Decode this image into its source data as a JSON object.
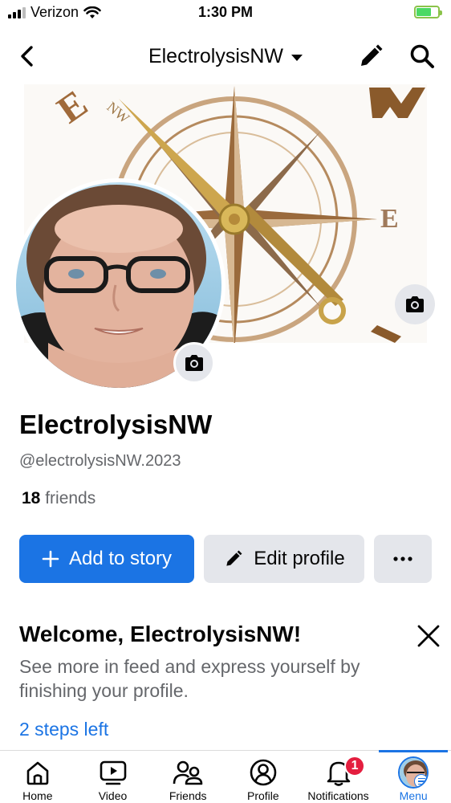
{
  "status_bar": {
    "carrier": "Verizon",
    "time": "1:30 PM"
  },
  "nav": {
    "title": "ElectrolysisNW"
  },
  "cover": {
    "logo_letters": [
      "E",
      "NW",
      "E"
    ],
    "accent": "#8a5a2b",
    "needle_color": "#c8a34a"
  },
  "profile": {
    "name": "ElectrolysisNW",
    "handle": "@electrolysisNW.2023",
    "friends_count": "18",
    "friends_label": "friends"
  },
  "actions": {
    "add_story": "Add to story",
    "edit_profile": "Edit profile",
    "more": "···"
  },
  "welcome": {
    "title": "Welcome, ElectrolysisNW!",
    "body": "See more in feed and express yourself by finishing your profile.",
    "steps": "2 steps left"
  },
  "tabs": [
    {
      "label": "Home",
      "icon": "home-icon"
    },
    {
      "label": "Video",
      "icon": "video-icon"
    },
    {
      "label": "Friends",
      "icon": "friends-icon"
    },
    {
      "label": "Profile",
      "icon": "profile-icon"
    },
    {
      "label": "Notifications",
      "icon": "bell-icon",
      "badge": "1"
    },
    {
      "label": "Menu",
      "icon": "menu-avatar-icon",
      "active": true
    }
  ],
  "colors": {
    "brand": "#1b74e4",
    "badge": "#e41e3f",
    "secondary_bg": "#e4e6eb"
  }
}
